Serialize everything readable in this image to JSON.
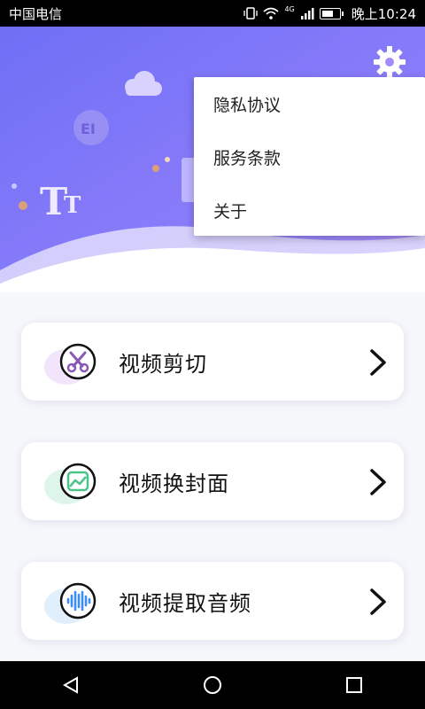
{
  "status_bar": {
    "carrier": "中国电信",
    "network": "4G",
    "time": "晚上10:24"
  },
  "header": {
    "settings_icon": "gear-icon"
  },
  "menu": {
    "items": [
      {
        "label": "隐私协议"
      },
      {
        "label": "服务条款"
      },
      {
        "label": "关于"
      }
    ]
  },
  "features": [
    {
      "label": "视频剪切",
      "icon": "scissors-icon",
      "accent": "#8a59b5"
    },
    {
      "label": "视频换封面",
      "icon": "image-icon",
      "accent": "#4cc48a"
    },
    {
      "label": "视频提取音频",
      "icon": "audio-wave-icon",
      "accent": "#3d8ef0"
    }
  ],
  "colors": {
    "hero_start": "#7a78f8",
    "hero_end": "#b592ff",
    "page_bg": "#f6f7fb"
  },
  "nav": {
    "back_icon": "back-triangle-icon",
    "home_icon": "home-circle-icon",
    "recents_icon": "recents-square-icon"
  }
}
